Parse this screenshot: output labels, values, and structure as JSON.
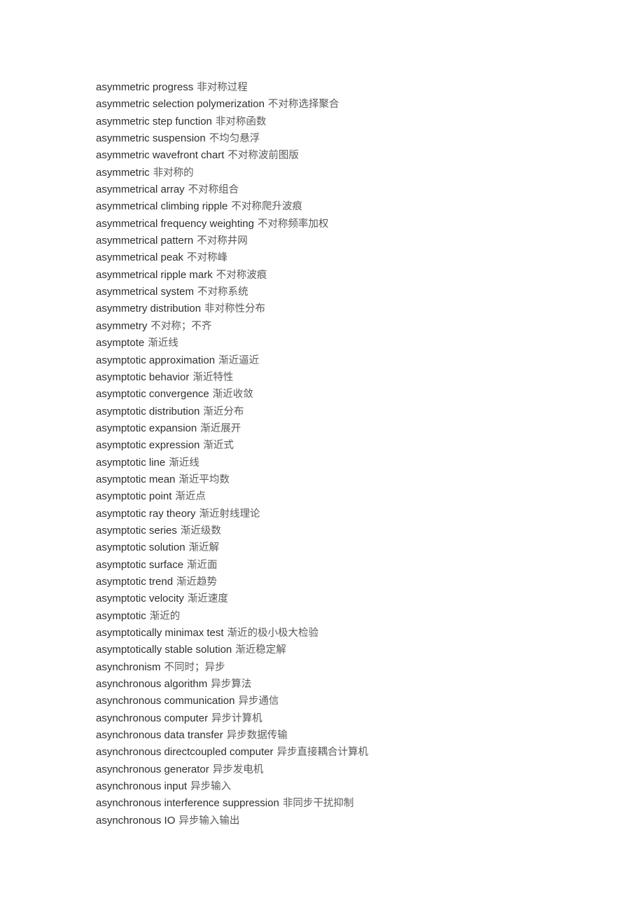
{
  "document": {
    "type": "bilingual-glossary-page",
    "page_background": "#ffffff",
    "term_color": "#2f2f2f",
    "definition_color": "#5a5a5a"
  },
  "entries": [
    {
      "term": "asymmetric progress",
      "definition": "非对称过程"
    },
    {
      "term": "asymmetric selection polymerization",
      "definition": "不对称选择聚合"
    },
    {
      "term": "asymmetric step function",
      "definition": "非对称函数"
    },
    {
      "term": "asymmetric suspension",
      "definition": "不均匀悬浮"
    },
    {
      "term": "asymmetric wavefront chart",
      "definition": "不对称波前图版"
    },
    {
      "term": "asymmetric",
      "definition": "非对称的"
    },
    {
      "term": "asymmetrical array",
      "definition": "不对称组合"
    },
    {
      "term": "asymmetrical climbing ripple",
      "definition": "不对称爬升波痕"
    },
    {
      "term": "asymmetrical frequency weighting",
      "definition": "不对称频率加权"
    },
    {
      "term": "asymmetrical pattern",
      "definition": "不对称井网"
    },
    {
      "term": "asymmetrical peak",
      "definition": "不对称峰"
    },
    {
      "term": "asymmetrical ripple mark",
      "definition": "不对称波痕"
    },
    {
      "term": "asymmetrical system",
      "definition": "不对称系统"
    },
    {
      "term": "asymmetry distribution",
      "definition": "非对称性分布"
    },
    {
      "term": "asymmetry",
      "definition": "不对称；不齐"
    },
    {
      "term": "asymptote",
      "definition": "渐近线"
    },
    {
      "term": "asymptotic approximation",
      "definition": "渐近逼近"
    },
    {
      "term": "asymptotic behavior",
      "definition": "渐近特性"
    },
    {
      "term": "asymptotic convergence",
      "definition": "渐近收敛"
    },
    {
      "term": "asymptotic distribution",
      "definition": "渐近分布"
    },
    {
      "term": "asymptotic expansion",
      "definition": "渐近展开"
    },
    {
      "term": "asymptotic expression",
      "definition": "渐近式"
    },
    {
      "term": "asymptotic line",
      "definition": "渐近线"
    },
    {
      "term": "asymptotic mean",
      "definition": "渐近平均数"
    },
    {
      "term": "asymptotic point",
      "definition": "渐近点"
    },
    {
      "term": "asymptotic ray theory",
      "definition": "渐近射线理论"
    },
    {
      "term": "asymptotic series",
      "definition": "渐近级数"
    },
    {
      "term": "asymptotic solution",
      "definition": "渐近解"
    },
    {
      "term": "asymptotic surface",
      "definition": "渐近面"
    },
    {
      "term": "asymptotic trend",
      "definition": "渐近趋势"
    },
    {
      "term": "asymptotic velocity",
      "definition": "渐近速度"
    },
    {
      "term": "asymptotic",
      "definition": "渐近的"
    },
    {
      "term": "asymptotically minimax test",
      "definition": "渐近的极小极大检验"
    },
    {
      "term": "asymptotically stable solution",
      "definition": "渐近稳定解"
    },
    {
      "term": "asynchronism",
      "definition": "不同时；异步"
    },
    {
      "term": "asynchronous algorithm",
      "definition": "异步算法"
    },
    {
      "term": "asynchronous communication",
      "definition": "异步通信"
    },
    {
      "term": "asynchronous computer",
      "definition": "异步计算机"
    },
    {
      "term": "asynchronous data transfer",
      "definition": "异步数据传输"
    },
    {
      "term": "asynchronous directcoupled computer",
      "definition": "异步直接耦合计算机"
    },
    {
      "term": "asynchronous generator",
      "definition": "异步发电机"
    },
    {
      "term": "asynchronous input",
      "definition": "异步输入"
    },
    {
      "term": "asynchronous interference suppression",
      "definition": "非同步干扰抑制"
    },
    {
      "term": "asynchronous IO",
      "definition": "异步输入输出"
    }
  ]
}
